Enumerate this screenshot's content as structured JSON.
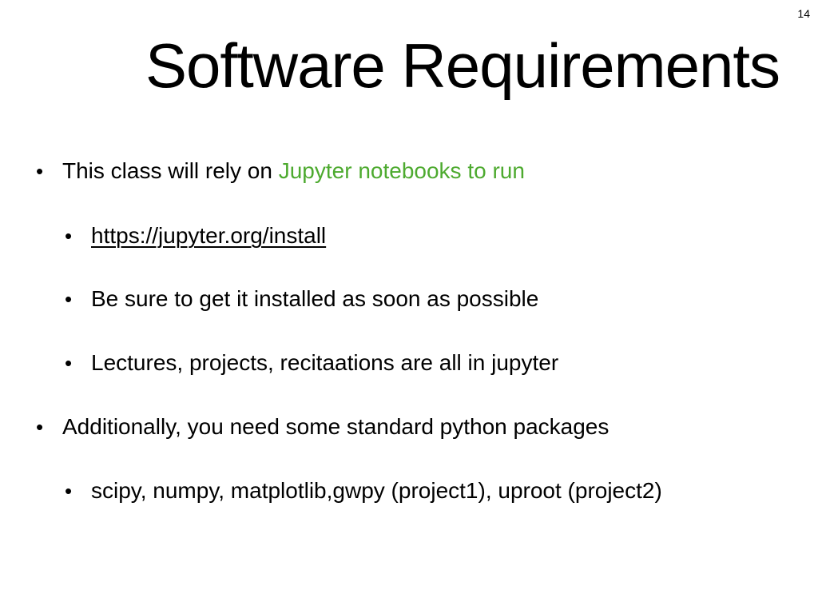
{
  "slide": {
    "number": "14",
    "title": "Software Requirements"
  },
  "colors": {
    "highlight": "#4daa2f",
    "text": "#000000",
    "background": "#ffffff"
  },
  "bullets": {
    "b1_prefix": "This class will rely on ",
    "b1_highlight": "Jupyter notebooks to run",
    "b2_link": "https://jupyter.org/install",
    "b3": "Be sure to get it installed as soon as possible",
    "b4": "Lectures, projects, recitaations are all in jupyter",
    "b5": "Additionally, you need some standard python packages",
    "b6": "scipy, numpy, matplotlib,gwpy (project1), uproot (project2)"
  }
}
